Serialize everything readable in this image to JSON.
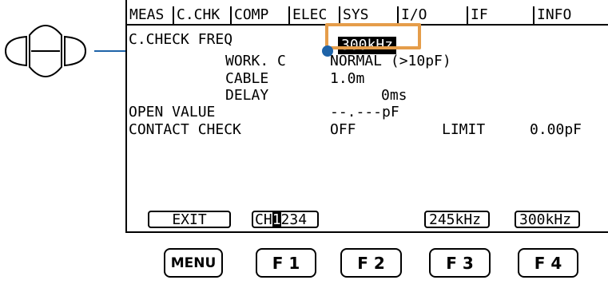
{
  "tabs": [
    "MEAS",
    "C.CHK",
    "COMP",
    "ELEC",
    "SYS",
    "I/O",
    "IF",
    "INFO"
  ],
  "screen": {
    "row1_label": "C.CHECK FREQ",
    "row1_value": "300kHz",
    "row2_label": "WORK. C",
    "row2_value": "NORMAL (>10pF)",
    "row3_label": "CABLE",
    "row3_value": "1.0m",
    "row4_label": "DELAY",
    "row4_value": "0ms",
    "row5_label": "OPEN VALUE",
    "row5_value": "--.---pF",
    "row6_label": "CONTACT CHECK",
    "row6_value": "OFF",
    "row6_limit_label": "LIMIT",
    "row6_limit_value": "0.00pF"
  },
  "softkeys": {
    "exit": "EXIT",
    "ch_prefix": "CH",
    "ch_selected": "1",
    "ch_rest": "234",
    "f3": "245kHz",
    "f4": "300kHz"
  },
  "buttons": [
    "MENU",
    "F 1",
    "F 2",
    "F 3",
    "F 4"
  ],
  "colors": {
    "highlight_box": "#e59d4a",
    "leader_line": "#1e63a8"
  }
}
